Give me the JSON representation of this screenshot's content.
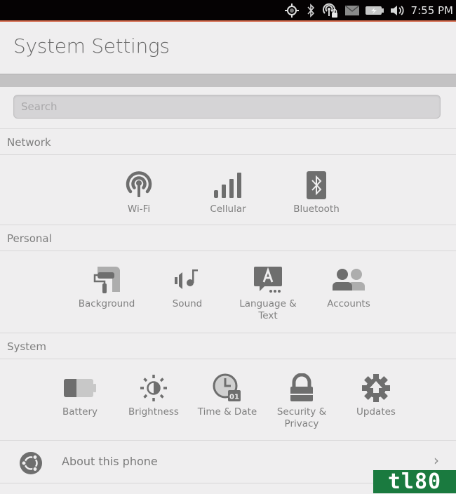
{
  "status_bar": {
    "icons": [
      "location-icon",
      "bluetooth-icon",
      "wifi-locked-icon",
      "messages-icon",
      "battery-charging-icon",
      "volume-icon"
    ],
    "time": "7:55 PM"
  },
  "header": {
    "title": "System Settings"
  },
  "search": {
    "placeholder": "Search",
    "value": ""
  },
  "sections": [
    {
      "title": "Network",
      "items": [
        {
          "label": "Wi-Fi",
          "icon": "wifi-icon"
        },
        {
          "label": "Cellular",
          "icon": "cellular-icon"
        },
        {
          "label": "Bluetooth",
          "icon": "bluetooth-icon"
        }
      ]
    },
    {
      "title": "Personal",
      "items": [
        {
          "label": "Background",
          "icon": "paint-roller-icon"
        },
        {
          "label": "Sound",
          "icon": "sound-icon"
        },
        {
          "label": "Language & Text",
          "icon": "language-icon"
        },
        {
          "label": "Accounts",
          "icon": "accounts-icon"
        }
      ]
    },
    {
      "title": "System",
      "items": [
        {
          "label": "Battery",
          "icon": "battery-icon"
        },
        {
          "label": "Brightness",
          "icon": "brightness-icon"
        },
        {
          "label": "Time & Date",
          "icon": "clock-icon"
        },
        {
          "label": "Security & Privacy",
          "icon": "lock-icon"
        },
        {
          "label": "Updates",
          "icon": "updates-gear-icon"
        }
      ]
    }
  ],
  "about": {
    "label": "About this phone",
    "icon": "ubuntu-logo-icon",
    "chevron": "›"
  },
  "watermark": {
    "text": "tl80"
  },
  "colors": {
    "accent": "#d46a4c",
    "icon": "#6e6e6e",
    "icon_light": "#adadad",
    "background": "#efeeef",
    "watermark": "#1a7a3f"
  }
}
